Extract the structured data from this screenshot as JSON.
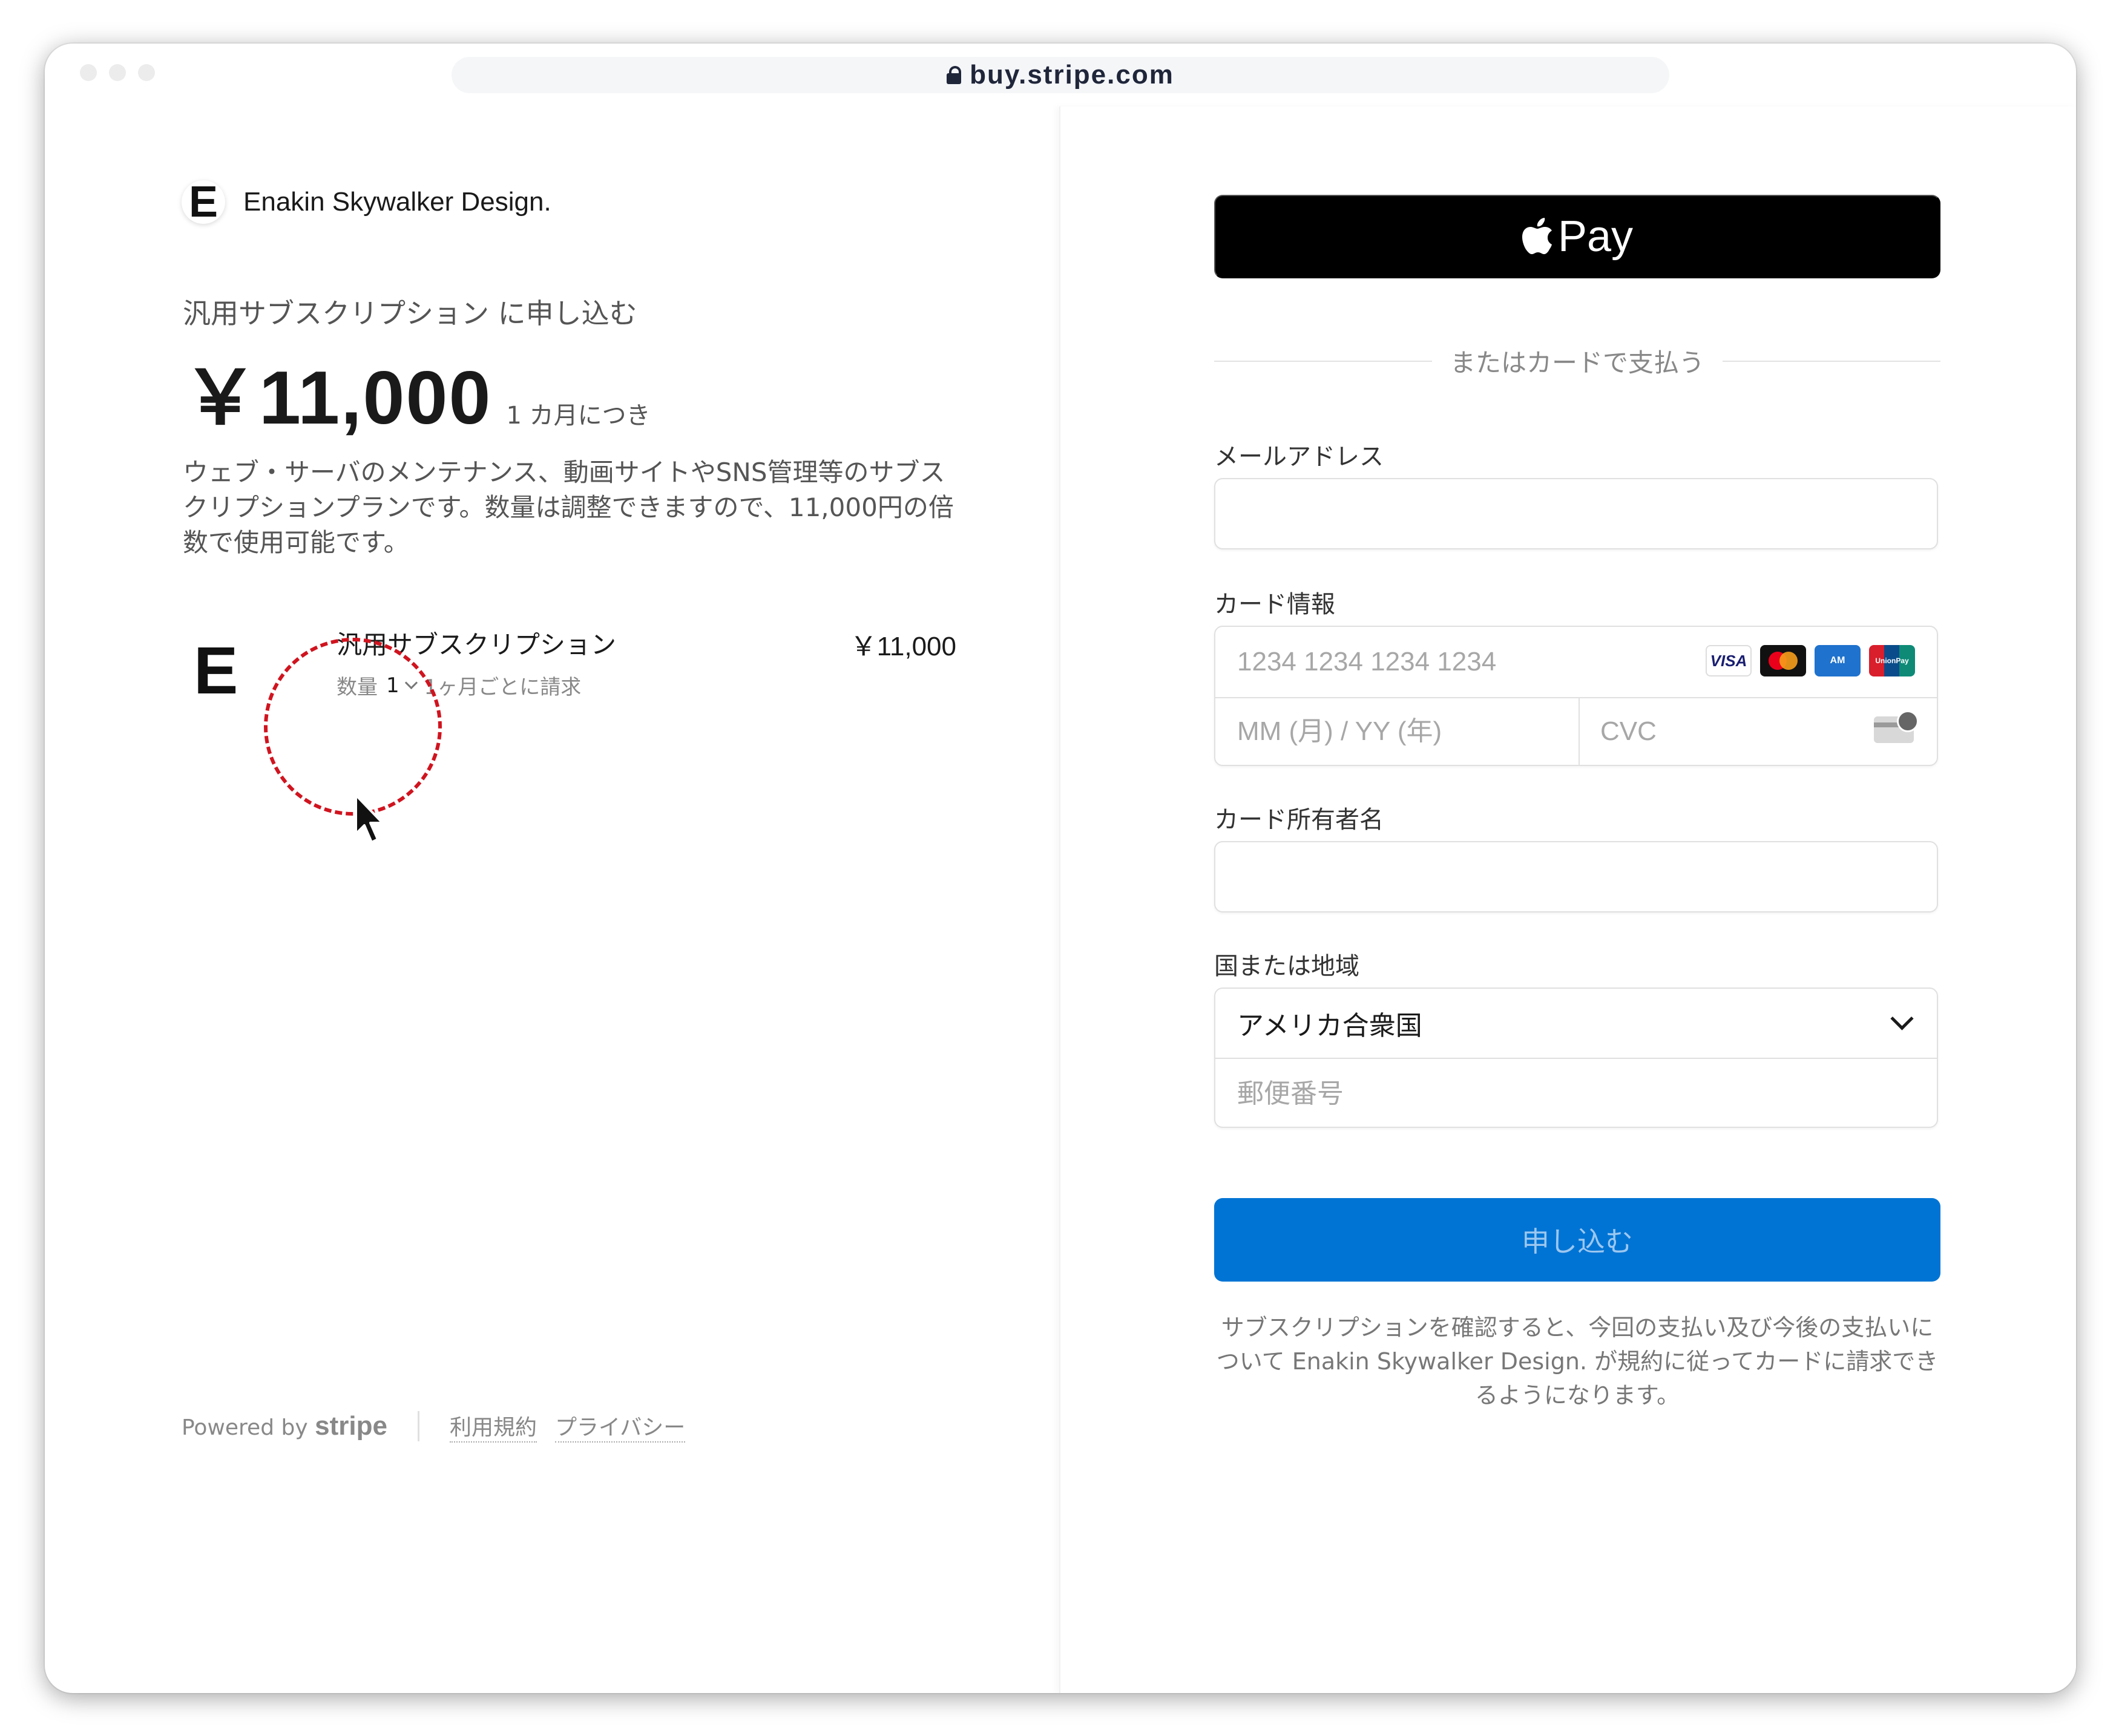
{
  "browser": {
    "url": "buy.stripe.com"
  },
  "merchant": {
    "logo_letter": "E",
    "name": "Enakin Skywalker Design."
  },
  "summary": {
    "subscribe_label": "汎用サブスクリプション に申し込む",
    "price": "￥11,000",
    "period": "1 カ月につき",
    "description": "ウェブ・サーバのメンテナンス、動画サイトやSNS管理等のサブスクリプションプランです。数量は調整できますので、11,000円の倍数で使用可能です。"
  },
  "line_item": {
    "logo_letter": "E",
    "name": "汎用サブスクリプション",
    "price": "￥11,000",
    "qty_label": "数量",
    "qty_value": "1",
    "billing": "1ヶ月ごとに請求"
  },
  "footer": {
    "powered_by": "Powered by",
    "stripe": "stripe",
    "terms": "利用規約",
    "privacy": "プライバシー"
  },
  "payment": {
    "apple_pay": "Pay",
    "divider": "またはカードで支払う",
    "email_label": "メールアドレス",
    "email_value": "",
    "card_label": "カード情報",
    "card_number_placeholder": "1234 1234 1234 1234",
    "expiry_placeholder": "MM (月) / YY (年)",
    "cvc_placeholder": "CVC",
    "brands": {
      "visa": "VISA",
      "amex": "AM",
      "unionpay": "UnionPay"
    },
    "cardholder_label": "カード所有者名",
    "cardholder_value": "",
    "country_label": "国または地域",
    "country_value": "アメリカ合衆国",
    "postal_placeholder": "郵便番号",
    "submit": "申し込む",
    "legal": "サブスクリプションを確認すると、今回の支払い及び今後の支払いについて Enakin Skywalker Design. が規約に従ってカードに請求できるようになります。"
  },
  "colors": {
    "accent": "#0074d4",
    "highlight": "#d0141f"
  }
}
